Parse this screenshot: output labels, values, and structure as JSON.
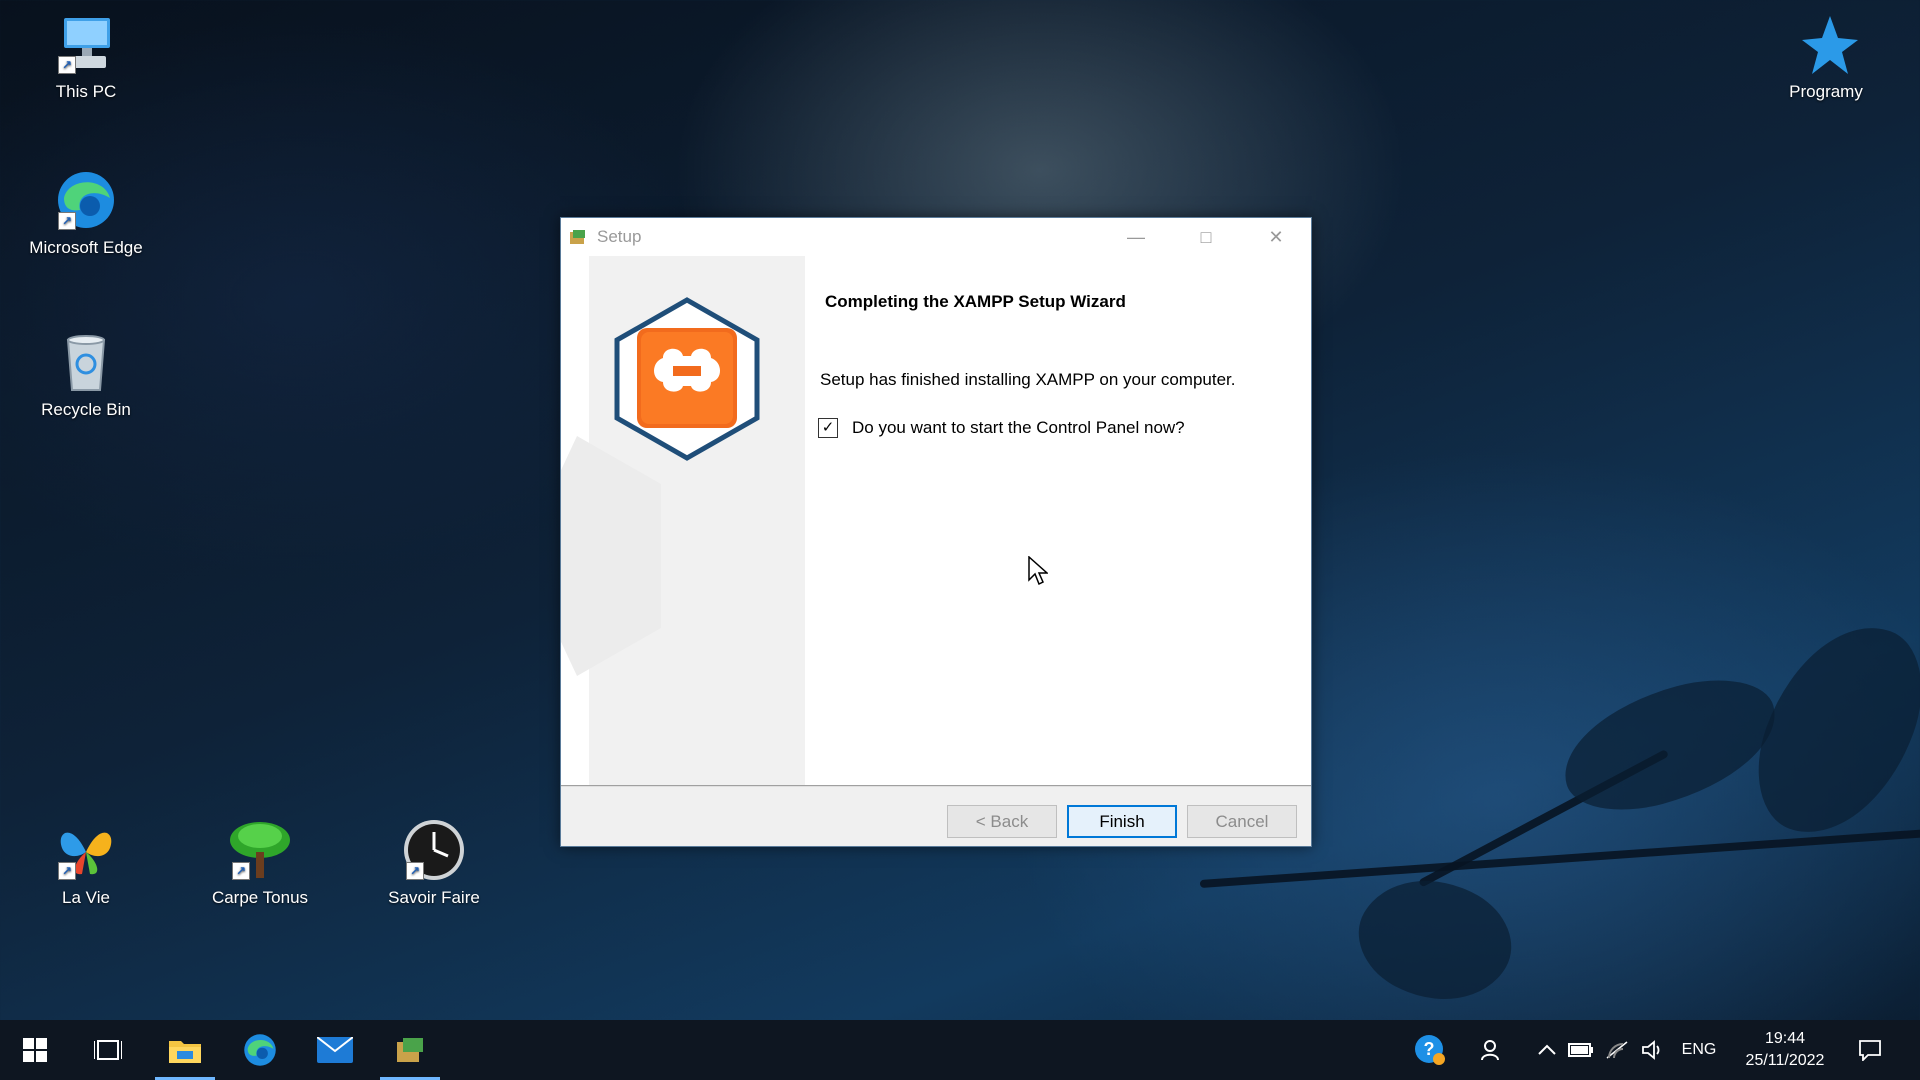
{
  "desktop": {
    "icons": [
      {
        "label": "This PC"
      },
      {
        "label": "Microsoft Edge"
      },
      {
        "label": "Recycle Bin"
      },
      {
        "label": "La Vie"
      },
      {
        "label": "Carpe Tonus"
      },
      {
        "label": "Savoir Faire"
      },
      {
        "label": "Programy"
      }
    ]
  },
  "dialog": {
    "title": "Setup",
    "heading": "Completing the XAMPP Setup Wizard",
    "message": "Setup has finished installing XAMPP on your computer.",
    "checkbox_label": "Do you want to start the Control Panel now?",
    "checkbox_checked": true,
    "buttons": {
      "back": "< Back",
      "finish": "Finish",
      "cancel": "Cancel"
    }
  },
  "taskbar": {
    "language": "ENG",
    "time": "19:44",
    "date": "25/11/2022"
  },
  "colors": {
    "xampp_orange": "#f26b1d",
    "xampp_navy": "#1f4e79",
    "taskbar": "#0e1621",
    "accent": "#0078d7"
  }
}
